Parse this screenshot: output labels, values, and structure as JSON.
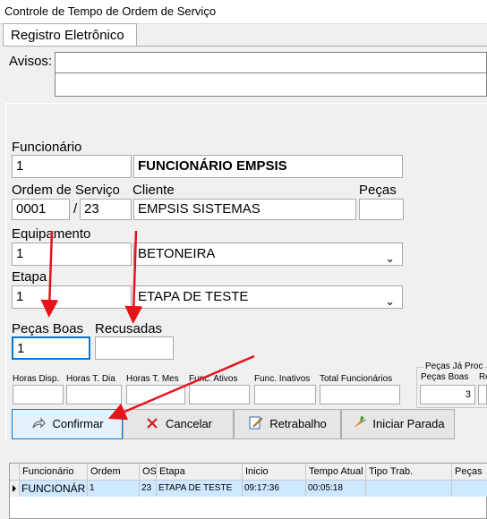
{
  "window": {
    "title": "Controle de Tempo de Ordem de Serviço"
  },
  "tabs": [
    {
      "label": "Registro Eletrônico"
    }
  ],
  "avisos": {
    "label": "Avisos:",
    "value": ""
  },
  "funcionario": {
    "label": "Funcionário",
    "code": "1",
    "name": "FUNCIONÁRIO EMPSIS"
  },
  "ordem": {
    "label": "Ordem de Serviço",
    "number": "0001",
    "separator": "/",
    "sub": "23",
    "cliente_label": "Cliente",
    "cliente": "EMPSIS SISTEMAS",
    "pecas_label": "Peças",
    "pecas": ""
  },
  "equipamento": {
    "label": "Equipamento",
    "code": "1",
    "selected": "BETONEIRA"
  },
  "etapa": {
    "label": "Etapa",
    "code": "1",
    "selected": "ETAPA DE TESTE"
  },
  "pecas_boas": {
    "label": "Peças Boas",
    "value": "1"
  },
  "recusadas": {
    "label": "Recusadas",
    "value": ""
  },
  "stats": [
    {
      "label": "Horas Disp.",
      "value": ""
    },
    {
      "label": "Horas T. Dia",
      "value": ""
    },
    {
      "label": "Horas T. Mes",
      "value": ""
    },
    {
      "label": "Func. Ativos",
      "value": ""
    },
    {
      "label": "Func. Inativos",
      "value": ""
    },
    {
      "label": "Total Funcionários",
      "value": ""
    }
  ],
  "pecas_ja_produzidas": {
    "label": "Peças Já Proc",
    "boas_label": "Peças Boas",
    "boas_value": "3",
    "re_label": "Re"
  },
  "buttons": {
    "confirmar": "Confirmar",
    "cancelar": "Cancelar",
    "retrabalho": "Retrabalho",
    "iniciar_parada": "Iniciar Parada"
  },
  "grid": {
    "columns": [
      "Funcionário",
      "Ordem",
      "OS",
      "Etapa",
      "Inicio",
      "Tempo Atual",
      "Tipo Trab.",
      "Peças"
    ],
    "rows": [
      [
        "FUNCIONÁR",
        "1",
        "23",
        "ETAPA DE TESTE",
        "09:17:36",
        "00:05:18",
        "",
        ""
      ]
    ]
  },
  "colors": {
    "annotation_arrow": "#e8131a",
    "selection": "#cde8ff",
    "focus_border": "#0078d7"
  },
  "icons": {
    "confirmar": "share-arrow-icon",
    "cancelar": "red-x-icon",
    "retrabalho": "edit-pencil-icon",
    "iniciar_parada": "carrot-icon"
  }
}
